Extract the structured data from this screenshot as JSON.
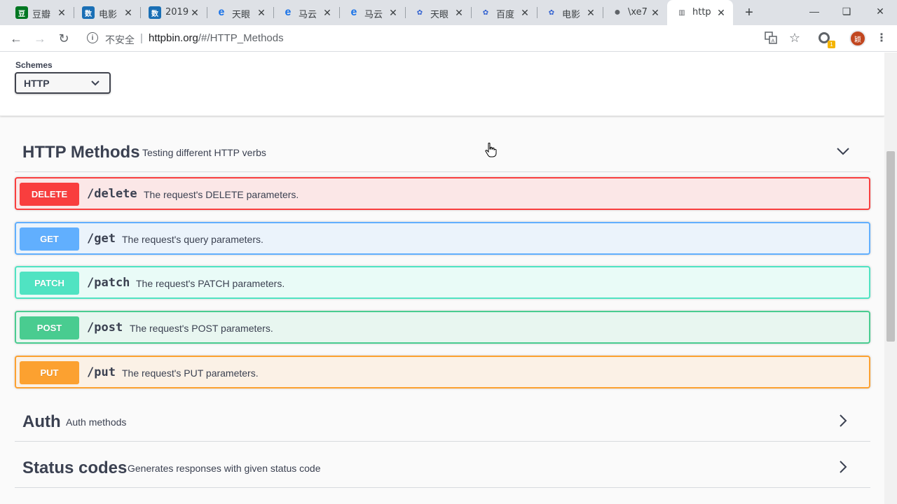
{
  "browser": {
    "tabs": [
      {
        "title": "豆瓣",
        "icon": "douban-icon",
        "color": "#007722",
        "glyph": "豆"
      },
      {
        "title": "电影",
        "icon": "news-icon",
        "color": "#1a6fb5",
        "glyph": "数"
      },
      {
        "title": "2019",
        "icon": "news-icon",
        "color": "#1a6fb5",
        "glyph": "数"
      },
      {
        "title": "天眼",
        "icon": "edge-icon",
        "color": "#1a73e8",
        "glyph": "e"
      },
      {
        "title": "马云",
        "icon": "edge-icon",
        "color": "#1a73e8",
        "glyph": "e"
      },
      {
        "title": "马云",
        "icon": "edge-icon",
        "color": "#1a73e8",
        "glyph": "e"
      },
      {
        "title": "天眼",
        "icon": "baidu-paw-icon",
        "color": "#2f5fd0",
        "glyph": "✿"
      },
      {
        "title": "百度",
        "icon": "baidu-paw-icon",
        "color": "#2f5fd0",
        "glyph": "✿"
      },
      {
        "title": "电影",
        "icon": "baidu-paw-icon",
        "color": "#2f5fd0",
        "glyph": "✿"
      },
      {
        "title": "\\xe7",
        "icon": "globe-icon",
        "color": "#5f6368",
        "glyph": "●"
      },
      {
        "title": "http",
        "icon": "trash-icon",
        "color": "#5f6368",
        "glyph": "▥"
      }
    ],
    "new_tab": "+",
    "insecure_label": "不安全",
    "url_host": "httpbin.org",
    "url_path": "/#/HTTP_Methods",
    "avatar_text": "颖",
    "ext_badge": "1"
  },
  "schemes": {
    "label": "Schemes",
    "selected": "HTTP"
  },
  "sections": {
    "http_methods": {
      "name": "HTTP Methods",
      "description": "Testing different HTTP verbs",
      "expanded": true
    },
    "auth": {
      "name": "Auth",
      "description": "Auth methods",
      "expanded": false
    },
    "status_codes": {
      "name": "Status codes",
      "description": "Generates responses with given status code",
      "expanded": false
    }
  },
  "operations": [
    {
      "method": "DELETE",
      "path": "/delete",
      "summary": "The request's DELETE parameters.",
      "color": "#f93e3e",
      "bg": "#fbe7e7",
      "border": "#f93e3e"
    },
    {
      "method": "GET",
      "path": "/get",
      "summary": "The request's query parameters.",
      "color": "#61affe",
      "bg": "#ebf3fb",
      "border": "#61affe"
    },
    {
      "method": "PATCH",
      "path": "/patch",
      "summary": "The request's PATCH parameters.",
      "color": "#50e3c2",
      "bg": "#e9fbf7",
      "border": "#50e3c2"
    },
    {
      "method": "POST",
      "path": "/post",
      "summary": "The request's POST parameters.",
      "color": "#49cc90",
      "bg": "#e8f6f0",
      "border": "#49cc90"
    },
    {
      "method": "PUT",
      "path": "/put",
      "summary": "The request's PUT parameters.",
      "color": "#fca130",
      "bg": "#fbf1e6",
      "border": "#fca130"
    }
  ]
}
